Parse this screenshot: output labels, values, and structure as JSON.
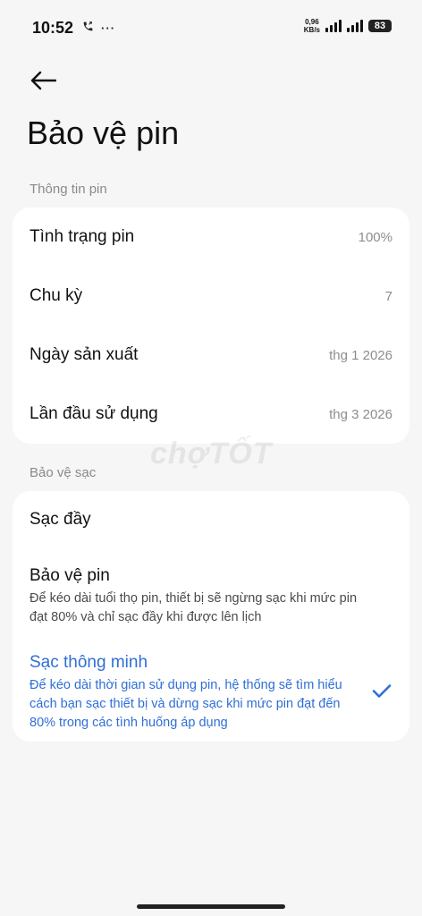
{
  "status_bar": {
    "time": "10:52",
    "left_icons": [
      "phone-call-icon",
      "more-dots-icon"
    ],
    "net_speed_value": "0,96",
    "net_speed_unit": "KB/s",
    "battery": "83"
  },
  "header": {
    "back_icon": "back-arrow-icon",
    "title": "Bảo vệ pin"
  },
  "battery_info": {
    "section_label": "Thông tin pin",
    "rows": [
      {
        "label": "Tình trạng pin",
        "value": "100%"
      },
      {
        "label": "Chu kỳ",
        "value": "7"
      },
      {
        "label": "Ngày sản xuất",
        "value": "thg 1 2026"
      },
      {
        "label": "Lần đầu sử dụng",
        "value": "thg 3 2026"
      }
    ]
  },
  "charge_protection": {
    "section_label": "Bảo vệ sạc",
    "options": [
      {
        "title": "Sạc đầy",
        "description": ""
      },
      {
        "title": "Bảo vệ pin",
        "description": "Để kéo dài tuổi thọ pin, thiết bị sẽ ngừng sạc khi mức pin đạt 80% và chỉ sạc đầy khi được lên lịch"
      },
      {
        "title": "Sạc thông minh",
        "description": "Để kéo dài thời gian sử dụng pin, hệ thống sẽ tìm hiểu cách bạn sạc thiết bị và dừng sạc khi mức pin đạt đến 80% trong các tình huống áp dụng",
        "selected": true
      }
    ]
  },
  "watermark": "chợTỐT",
  "colors": {
    "accent": "#2f6fd6",
    "background": "#f6f6f6",
    "card": "#ffffff"
  }
}
